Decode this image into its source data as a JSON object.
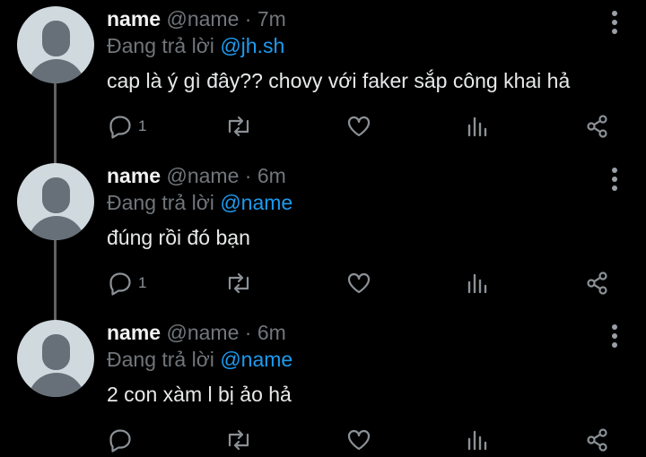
{
  "tweets": [
    {
      "name": "name",
      "handle": "@name",
      "separator": "·",
      "time": "7m",
      "reply_prefix": "Đang trả lời",
      "reply_to": "@jh.sh",
      "text": "cap là ý gì đây?? chovy với faker sắp công khai hả",
      "reply_count": "1"
    },
    {
      "name": "name",
      "handle": "@name",
      "separator": "·",
      "time": "6m",
      "reply_prefix": "Đang trả lời",
      "reply_to": "@name",
      "text": "đúng rồi đó bạn",
      "reply_count": "1"
    },
    {
      "name": "name",
      "handle": "@name",
      "separator": "·",
      "time": "6m",
      "reply_prefix": "Đang trả lời",
      "reply_to": "@name",
      "text": "2 con xàm l bị ảo hả",
      "reply_count": ""
    }
  ],
  "icons": {
    "more": "more-vertical-icon",
    "reply": "reply-bubble-icon",
    "retweet": "retweet-icon",
    "like": "heart-icon",
    "views": "analytics-bars-icon",
    "share": "share-icon"
  },
  "colors": {
    "background": "#000000",
    "text": "#e7e9ea",
    "muted": "#71767b",
    "link": "#1d9bf0",
    "thread_line": "#5f6163"
  }
}
